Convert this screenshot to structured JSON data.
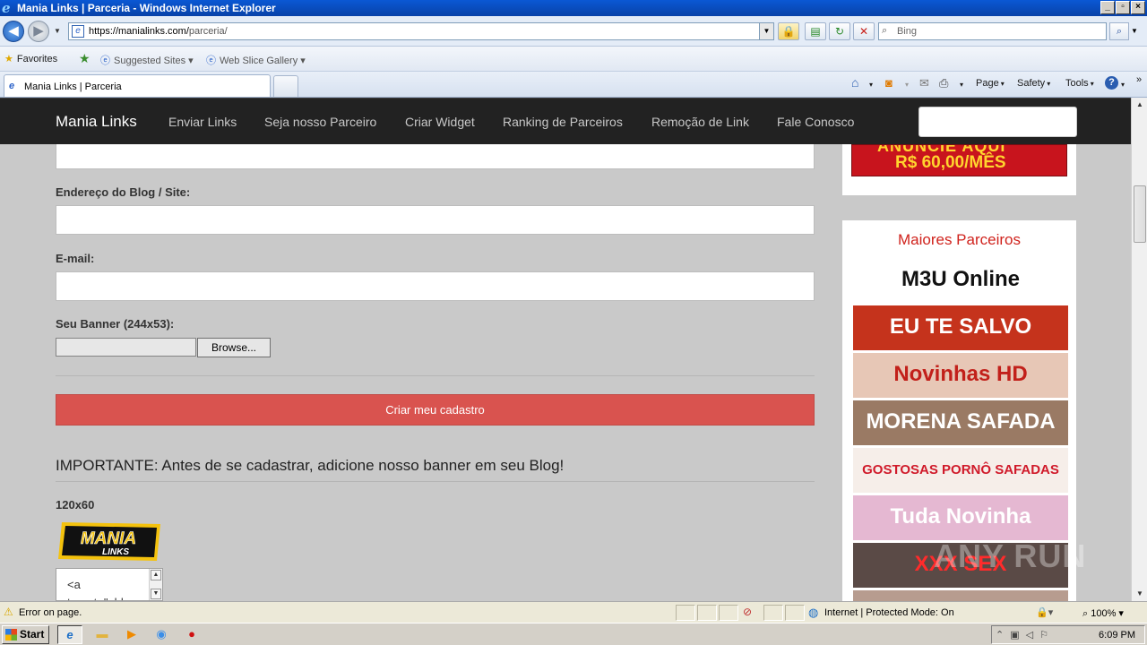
{
  "window": {
    "title": "Mania Links | Parceria - Windows Internet Explorer"
  },
  "addressbar": {
    "url_host": "https://manialinks.com/",
    "url_path": "parceria/",
    "search_placeholder": "Bing"
  },
  "favorites": {
    "favorites_label": "Favorites",
    "suggested_sites": "Suggested Sites",
    "web_slice_gallery": "Web Slice Gallery"
  },
  "tabs": [
    {
      "label": "Mania Links | Parceria"
    }
  ],
  "commandbar": {
    "page": "Page",
    "safety": "Safety",
    "tools": "Tools"
  },
  "site": {
    "brand": "Mania Links",
    "nav": [
      "Enviar Links",
      "Seja nosso Parceiro",
      "Criar Widget",
      "Ranking de Parceiros",
      "Remoção de Link",
      "Fale Conosco"
    ]
  },
  "form": {
    "blog_label": "Endereço do Blog / Site:",
    "email_label": "E-mail:",
    "banner_label": "Seu Banner (244x53):",
    "browse_label": "Browse...",
    "submit_label": "Criar meu cadastro",
    "important_text": "IMPORTANTE: Antes de se cadastrar, adicione nosso banner em seu Blog!",
    "size_label": "120x60",
    "logo_top": "MANIA",
    "logo_bottom": "LINKS",
    "code_line1": "<a",
    "code_line2": "target=\"_bla"
  },
  "sidebar": {
    "ad_top": "ANUNCIE AQUI",
    "ad_price": "R$ 60,00/MÊS",
    "partners_title": "Maiores Parceiros",
    "partners": [
      {
        "text": "M3U Online",
        "bg": "#ffffff",
        "fg": "#111111"
      },
      {
        "text": "EU TE SALVO",
        "bg": "#c5331c",
        "fg": "#ffffff"
      },
      {
        "text": "Novinhas HD",
        "bg": "#e7c7b6",
        "fg": "#c2201a"
      },
      {
        "text": "MORENA SAFADA",
        "bg": "#9a7a64",
        "fg": "#ffffff"
      },
      {
        "text": "GOSTOSAS PORNÔ SAFADAS",
        "bg": "#f6eee9",
        "fg": "#d01a2a"
      },
      {
        "text": "Tuda Novinha",
        "bg": "#e5b8d2",
        "fg": "#ffffff"
      },
      {
        "text": "XXX SEX",
        "bg": "#5a4a46",
        "fg": "#ff2b2b"
      }
    ]
  },
  "statusbar": {
    "error_text": "Error on page.",
    "zone_text": "Internet | Protected Mode: On",
    "zoom": "100%"
  },
  "taskbar": {
    "start": "Start",
    "clock": "6:09 PM"
  },
  "watermark": "ANY RUN",
  "colors": {
    "navbar_bg": "#222222",
    "submit_bg": "#d9534f",
    "partners_title": "#d0231d",
    "page_bg": "#c9c9c9"
  }
}
